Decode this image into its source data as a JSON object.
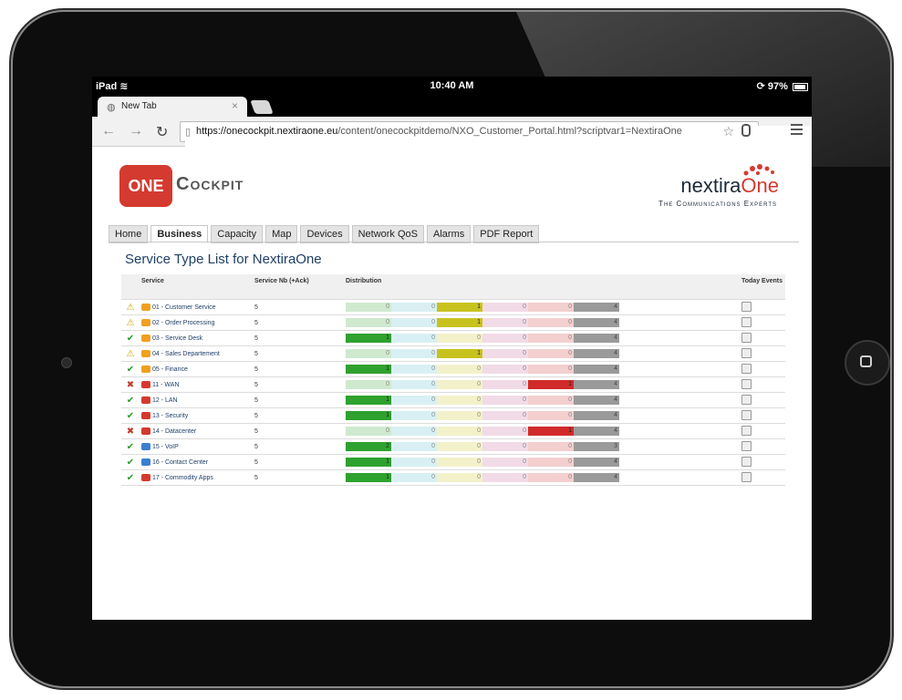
{
  "status_bar": {
    "carrier": "iPad",
    "time": "10:40 AM",
    "battery": "97%"
  },
  "browser": {
    "tab_title": "New Tab",
    "url_host": "https://onecockpit.nextiraone.eu",
    "url_path": "/content/onecockpitdemo/NXO_Customer_Portal.html?scriptvar1=NextiraOne"
  },
  "header": {
    "logo_badge": "ONE",
    "logo_name": "Cockpit",
    "brand_part1": "nextira",
    "brand_part2": "One",
    "tagline": "The Communications Experts"
  },
  "nav": {
    "items": [
      "Home",
      "Business",
      "Capacity",
      "Map",
      "Devices",
      "Network QoS",
      "Alarms",
      "PDF Report"
    ],
    "active": "Business"
  },
  "page_title": "Service Type List for NextiraOne",
  "table": {
    "columns": {
      "service": "Service",
      "nb": "Service Nb (+Ack)",
      "dist": "Distribution",
      "events": "Today Events"
    },
    "distribution_colors": {
      "green": "#2fa12f",
      "cyan": "#a9dfe6",
      "yellow": "#c8c21e",
      "pink": "#e7b9d3",
      "red": "#d12a2a",
      "grey": "#9a9a9a"
    },
    "rows": [
      {
        "status": "warn",
        "icon_color": "#f0a020",
        "name": "01 - Customer Service",
        "nb": "5",
        "dist": [
          "0",
          "0",
          "1",
          "0",
          "0",
          "4"
        ]
      },
      {
        "status": "warn",
        "icon_color": "#f0a020",
        "name": "02 - Order Processing",
        "nb": "5",
        "dist": [
          "0",
          "0",
          "1",
          "0",
          "0",
          "4"
        ]
      },
      {
        "status": "ok",
        "icon_color": "#f0a020",
        "name": "03 - Service Desk",
        "nb": "5",
        "dist": [
          "1",
          "0",
          "0",
          "0",
          "0",
          "4"
        ]
      },
      {
        "status": "warn",
        "icon_color": "#f0a020",
        "name": "04 - Sales Departement",
        "nb": "5",
        "dist": [
          "0",
          "0",
          "1",
          "0",
          "0",
          "4"
        ]
      },
      {
        "status": "ok",
        "icon_color": "#f0a020",
        "name": "05 - Finance",
        "nb": "5",
        "dist": [
          "1",
          "0",
          "0",
          "0",
          "0",
          "4"
        ]
      },
      {
        "status": "err",
        "icon_color": "#d43a2f",
        "name": "11 - WAN",
        "nb": "5",
        "dist": [
          "0",
          "0",
          "0",
          "0",
          "1",
          "4"
        ]
      },
      {
        "status": "ok",
        "icon_color": "#d43a2f",
        "name": "12 - LAN",
        "nb": "5",
        "dist": [
          "1",
          "0",
          "0",
          "0",
          "0",
          "4"
        ]
      },
      {
        "status": "ok",
        "icon_color": "#d43a2f",
        "name": "13 - Security",
        "nb": "5",
        "dist": [
          "1",
          "0",
          "0",
          "0",
          "0",
          "4"
        ]
      },
      {
        "status": "err",
        "icon_color": "#d43a2f",
        "name": "14 - Datacenter",
        "nb": "5",
        "dist": [
          "0",
          "0",
          "0",
          "0",
          "1",
          "4"
        ]
      },
      {
        "status": "ok",
        "icon_color": "#3b7fd0",
        "name": "15 - VoIP",
        "nb": "5",
        "dist": [
          "2",
          "0",
          "0",
          "0",
          "0",
          "3"
        ]
      },
      {
        "status": "ok",
        "icon_color": "#3b7fd0",
        "name": "16 - Contact Center",
        "nb": "5",
        "dist": [
          "1",
          "0",
          "0",
          "0",
          "0",
          "4"
        ]
      },
      {
        "status": "ok",
        "icon_color": "#d43a2f",
        "name": "17 - Commodity Apps",
        "nb": "5",
        "dist": [
          "1",
          "0",
          "0",
          "0",
          "0",
          "4"
        ]
      }
    ]
  }
}
